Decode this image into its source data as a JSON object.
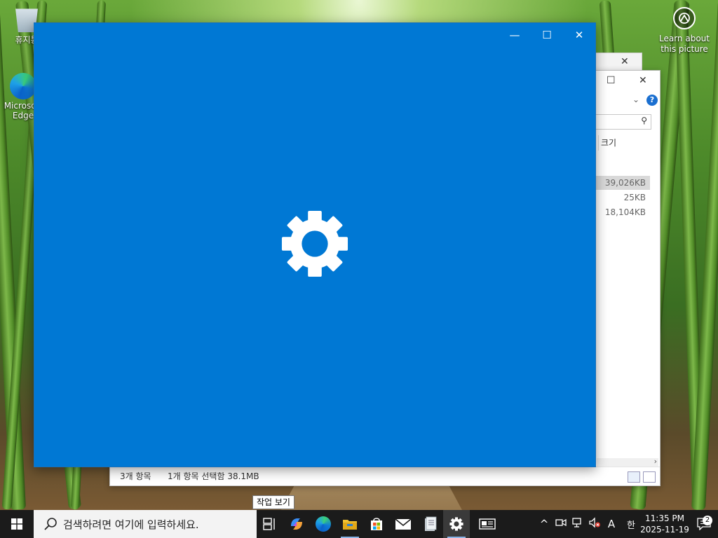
{
  "desktop": {
    "icons": [
      {
        "label": "휴지통"
      },
      {
        "label": "Microsoft Edge"
      }
    ],
    "learn_about": "Learn about this picture"
  },
  "explorer": {
    "column_size_header": "크기",
    "rows": [
      "39,026KB",
      "25KB",
      "18,104KB"
    ],
    "status_items": "3개 항목",
    "status_selected": "1개 항목 선택함 38.1MB"
  },
  "settings_window": {
    "background_color": "#0078d4",
    "icon": "gear-icon"
  },
  "tooltip": {
    "text": "작업 보기"
  },
  "taskbar": {
    "search_placeholder": "검색하려면 여기에 입력하세요.",
    "apps": [
      {
        "icon": "task-view-icon"
      },
      {
        "icon": "copilot-icon"
      },
      {
        "icon": "edge-icon"
      },
      {
        "icon": "file-explorer-icon"
      },
      {
        "icon": "store-icon"
      },
      {
        "icon": "mail-icon"
      },
      {
        "icon": "notepad-icon"
      },
      {
        "icon": "settings-icon"
      },
      {
        "icon": "news-icon"
      }
    ],
    "tray": {
      "ime_mode": "A",
      "ime_lang": "한"
    },
    "clock_time": "11:35 PM",
    "clock_date": "2025-11-19",
    "notification_count": "2"
  }
}
